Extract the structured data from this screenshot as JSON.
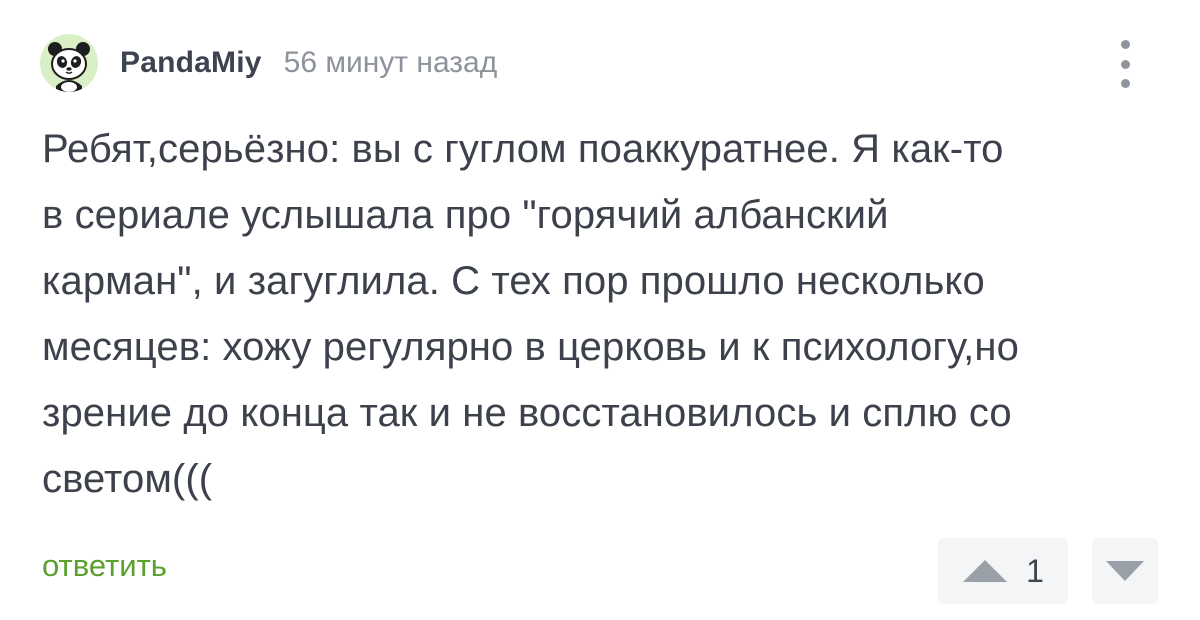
{
  "comment": {
    "author": "PandaMiy",
    "time": "56 минут назад",
    "text": "Ребят,серьёзно: вы с гуглом поаккуратнее. Я как-то\nв сериале услышала про \"горячий албанский\nкарман\", и загуглила. С тех пор прошло несколько\nмесяцев: хожу регулярно в церковь и к психологу,но\nзрение до конца так и не восстановилось и сплю со\nсветом(((",
    "reply_label": "ответить",
    "rating": "1"
  },
  "icons": {
    "avatar": "panda-icon",
    "more": "more-vertical-icon",
    "upvote": "triangle-up-icon",
    "downvote": "triangle-down-icon"
  },
  "colors": {
    "accent_green": "#5aa02d",
    "avatar_bg": "#d9f0c7",
    "vote_bg": "#f4f5f6",
    "text": "#3c414b",
    "muted": "#8d929b"
  }
}
